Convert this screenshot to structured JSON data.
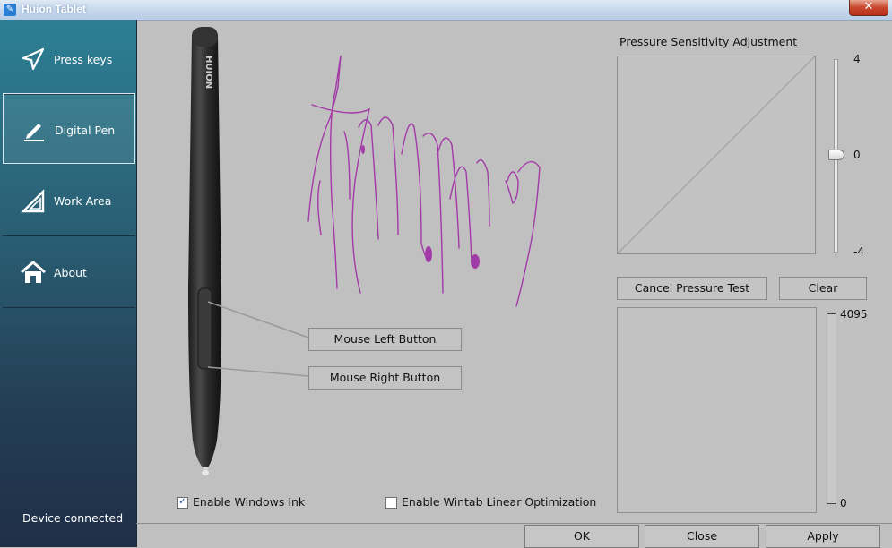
{
  "window": {
    "title": "Huion Tablet",
    "close_label": "✕"
  },
  "sidebar": {
    "items": [
      {
        "label": "Press keys",
        "icon": "send-icon"
      },
      {
        "label": "Digital Pen",
        "icon": "pen-icon",
        "active": true
      },
      {
        "label": "Work Area",
        "icon": "triangle-ruler-icon"
      },
      {
        "label": "About",
        "icon": "home-icon"
      }
    ],
    "status": "Device connected"
  },
  "pen": {
    "brand": "HUION",
    "left_button": "Mouse Left Button",
    "right_button": "Mouse Right Button"
  },
  "options": {
    "windows_ink": {
      "label": "Enable Windows Ink",
      "checked": true
    },
    "wintab_linear": {
      "label": "Enable Wintab Linear Optimization",
      "checked": false
    }
  },
  "pressure": {
    "title": "Pressure Sensitivity Adjustment",
    "slider_max": "4",
    "slider_value": "0",
    "slider_min": "-4",
    "cancel_label": "Cancel Pressure Test",
    "clear_label": "Clear",
    "meter_max": "4095",
    "meter_min": "0",
    "stroke_color": "#a23aa8"
  },
  "footer": {
    "ok": "OK",
    "close": "Close",
    "apply": "Apply"
  }
}
